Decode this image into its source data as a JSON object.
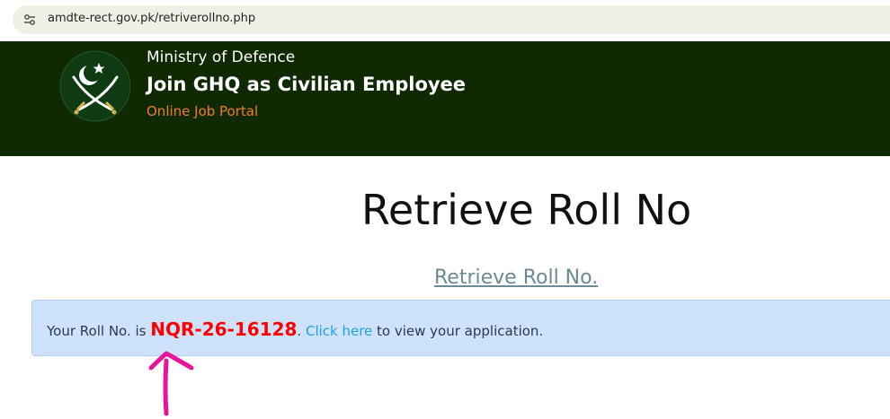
{
  "browser": {
    "url": "amdte-rect.gov.pk/retriverollno.php",
    "site_icon": "tune-icon"
  },
  "header": {
    "ministry": "Ministry of Defence",
    "title": "Join GHQ as Civilian Employee",
    "subtitle": "Online Job Portal",
    "logo_icon": "army-crest-icon"
  },
  "main": {
    "page_title": "Retrieve Roll No",
    "retrieve_link": "Retrieve Roll No."
  },
  "alert": {
    "prefix": "Your Roll No. is ",
    "roll_no": "NQR-26-16128",
    "dot": ".",
    "link_text": "Click here",
    "suffix": " to view your application."
  },
  "annotation": {
    "arrow_icon": "pink-arrow-up-icon"
  },
  "colors": {
    "header_bg": "#0f2a03",
    "subtitle": "#f47c20",
    "roll_no": "#ff0000",
    "link": "#1da1e4",
    "alert_bg": "#cfe2fd",
    "arrow": "#e8149a"
  }
}
